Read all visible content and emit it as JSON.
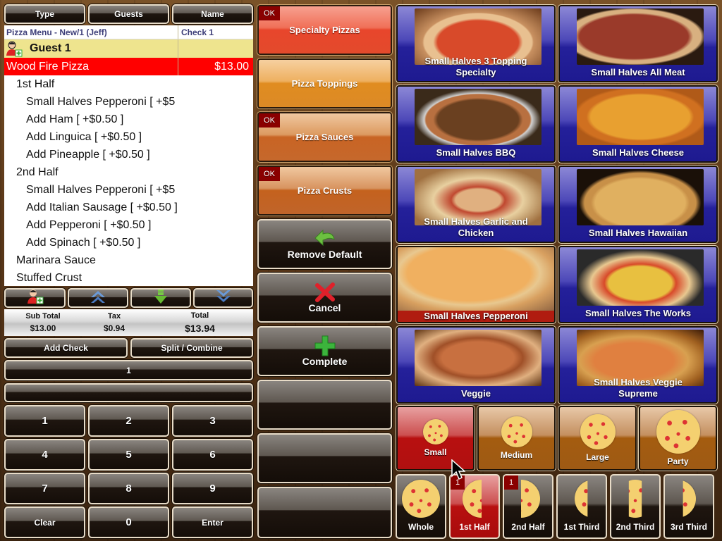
{
  "top_tabs": [
    {
      "label": "Type"
    },
    {
      "label": "Guests"
    },
    {
      "label": "Name"
    }
  ],
  "order": {
    "header_title": "Pizza Menu - New/1 (Jeff)",
    "check_label": "Check 1",
    "guest_label": "Guest 1",
    "item": {
      "name": "Wood Fire Pizza",
      "price": "$13.00"
    },
    "lines": [
      {
        "text": "1st Half",
        "level": 1
      },
      {
        "text": "Small Halves Pepperoni  [ +$5",
        "level": 2
      },
      {
        "text": "Add Ham [ +$0.50 ]",
        "level": 2
      },
      {
        "text": "Add Linguica [ +$0.50 ]",
        "level": 2
      },
      {
        "text": "Add Pineapple [ +$0.50 ]",
        "level": 2
      },
      {
        "text": "2nd Half",
        "level": 1
      },
      {
        "text": "Small Halves Pepperoni  [ +$5",
        "level": 2
      },
      {
        "text": "Add Italian Sausage [ +$0.50 ]",
        "level": 2
      },
      {
        "text": "Add Pepperoni [ +$0.50 ]",
        "level": 2
      },
      {
        "text": "Add Spinach [ +$0.50 ]",
        "level": 2
      },
      {
        "text": "Marinara Sauce",
        "level": 1
      },
      {
        "text": "Stuffed Crust",
        "level": 1
      }
    ]
  },
  "order_tools": [
    {
      "icon": "add-guest-icon"
    },
    {
      "icon": "scroll-up-icon"
    },
    {
      "icon": "move-down-icon"
    },
    {
      "icon": "scroll-down-icon"
    }
  ],
  "totals": {
    "subtotal_label": "Sub Total",
    "subtotal": "$13.00",
    "tax_label": "Tax",
    "tax": "$0.94",
    "total_label": "Total",
    "total": "$13.94"
  },
  "check_actions": {
    "add_check": "Add Check",
    "split_combine": "Split / Combine"
  },
  "quantity_display": "1",
  "entry_display": "",
  "keypad": [
    "1",
    "2",
    "3",
    "4",
    "5",
    "6",
    "7",
    "8",
    "9",
    "Clear",
    "0",
    "Enter"
  ],
  "categories": [
    {
      "label": "Specialty Pizzas",
      "ok": "OK",
      "color": "#e34a2c"
    },
    {
      "label": "Pizza Toppings",
      "ok": "",
      "color": "#dc8a26"
    },
    {
      "label": "Pizza Sauces",
      "ok": "OK",
      "color": "#c6682c"
    },
    {
      "label": "Pizza Crusts",
      "ok": "OK",
      "color": "#c0642a"
    }
  ],
  "actions": {
    "remove_default": "Remove Default",
    "cancel": "Cancel",
    "complete": "Complete"
  },
  "pizzas": [
    {
      "name": "Small Halves 3 Topping Specialty",
      "selected": false
    },
    {
      "name": "Small Halves All Meat",
      "selected": false
    },
    {
      "name": "Small Halves BBQ",
      "selected": false
    },
    {
      "name": "Small Halves Cheese",
      "selected": false
    },
    {
      "name": "Small Halves Garlic and Chicken",
      "selected": false
    },
    {
      "name": "Small Halves Hawaiian",
      "selected": false
    },
    {
      "name": "Small Halves Pepperoni",
      "selected": true
    },
    {
      "name": "Small Halves The Works",
      "selected": false
    },
    {
      "name": "Veggie",
      "selected": false
    },
    {
      "name": "Small Halves Veggie Supreme",
      "selected": false
    }
  ],
  "sizes": [
    {
      "label": "Small",
      "active": true
    },
    {
      "label": "Medium",
      "active": false
    },
    {
      "label": "Large",
      "active": false
    },
    {
      "label": "Party",
      "active": false
    }
  ],
  "portions": [
    {
      "label": "Whole",
      "active": false,
      "count": ""
    },
    {
      "label": "1st Half",
      "active": true,
      "count": "1"
    },
    {
      "label": "2nd Half",
      "active": false,
      "count": "1"
    },
    {
      "label": "1st Third",
      "active": false,
      "count": ""
    },
    {
      "label": "2nd Third",
      "active": false,
      "count": ""
    },
    {
      "label": "3rd Third",
      "active": false,
      "count": ""
    }
  ],
  "colors": {
    "selected_item": "#ff0000",
    "guest_row": "#eee48e",
    "tile_blue": "#24209a",
    "active_red": "#b81010"
  }
}
